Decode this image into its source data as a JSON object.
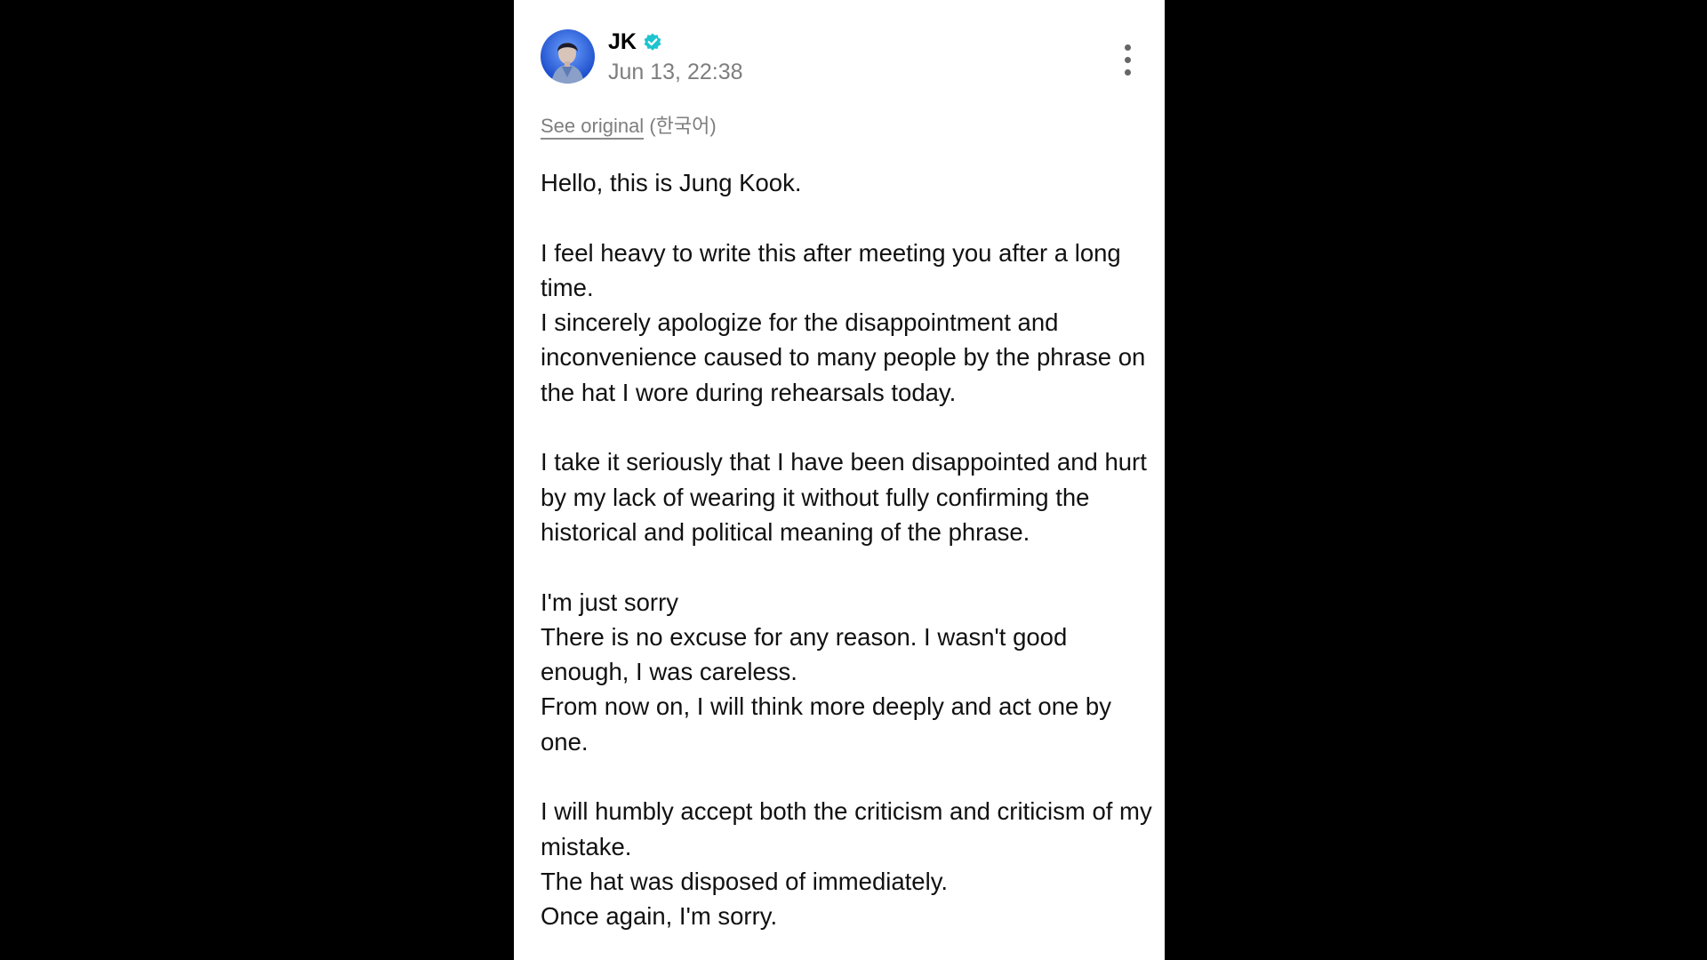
{
  "post": {
    "author": {
      "name": "JK",
      "verified": true,
      "avatar_icon": "profile-photo-avatar"
    },
    "timestamp": "Jun 13, 22:38",
    "more_icon": "more-vertical-icon",
    "translation": {
      "see_original_label": "See original",
      "language_label": "(한국어)"
    },
    "paragraphs": [
      "Hello, this is Jung Kook.",
      "I feel heavy to write this after meeting you after a long time.\nI sincerely apologize for the disappointment and inconvenience caused to many people by the phrase on the hat I wore during rehearsals today.",
      "I take it seriously that I have been disappointed and hurt by my lack of wearing it without fully confirming the historical and political meaning of the phrase.",
      "I'm just sorry\nThere is no excuse for any reason. I wasn't good enough, I was careless.\nFrom now on, I will think more deeply and act one by one.",
      "I will humbly accept both the criticism and criticism of my mistake.\nThe hat was disposed of immediately.\nOnce again, I'm sorry."
    ]
  },
  "colors": {
    "background": "#000000",
    "card": "#ffffff",
    "text": "#111111",
    "muted": "#7e7e7e",
    "verified_badge": "#1dc4d0"
  }
}
